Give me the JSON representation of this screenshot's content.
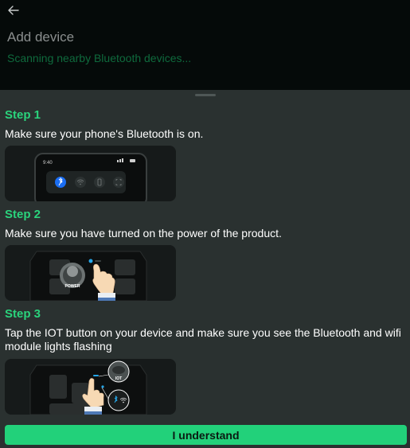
{
  "header": {
    "back_icon": "arrow-left-icon",
    "title": "Add device",
    "scan_status": "Scanning nearby Bluetooth devices..."
  },
  "steps": [
    {
      "title": "Step 1",
      "description": "Make sure your phone's Bluetooth is on.",
      "illustration": {
        "phone_time": "9:40"
      }
    },
    {
      "title": "Step 2",
      "description": "Make sure you have turned on the power of the product.",
      "illustration": {
        "button_label": "POWER"
      }
    },
    {
      "title": "Step 3",
      "description": "Tap the IOT button on your device and make sure you see the Bluetooth and wifi module lights flashing",
      "illustration": {
        "button_label": "IOT"
      }
    }
  ],
  "confirm_button": "I understand",
  "colors": {
    "accent": "#22d17a",
    "sheet_bg": "#2a3130",
    "header_bg": "#050a09",
    "scan_text": "#0f6a3d"
  }
}
